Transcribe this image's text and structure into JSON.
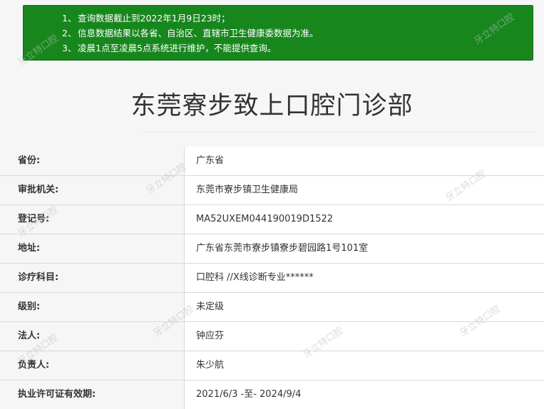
{
  "notice": [
    {
      "num": "1、",
      "text": "查询数据截止到2022年1月9日23时；"
    },
    {
      "num": "2、",
      "text": "信息数据结果以各省、自治区、直辖市卫生健康委数据为准。"
    },
    {
      "num": "3、",
      "text": "凌晨1点至凌晨5点系统进行维护，不能提供查询。"
    }
  ],
  "title": "东莞寮步致上口腔门诊部",
  "rows": [
    {
      "label": "省份:",
      "value": "广东省"
    },
    {
      "label": "审批机关:",
      "value": "东莞市寮步镇卫生健康局"
    },
    {
      "label": "登记号:",
      "value": "MA52UXEM044190019D1522"
    },
    {
      "label": "地址:",
      "value": "广东省东莞市寮步镇寮步碧园路1号101室"
    },
    {
      "label": "诊疗科目:",
      "value": "口腔科 //X线诊断专业******"
    },
    {
      "label": "级别:",
      "value": "未定级"
    },
    {
      "label": "法人:",
      "value": "钟应芬"
    },
    {
      "label": "负责人:",
      "value": "朱少航"
    },
    {
      "label": "执业许可证有效期:",
      "value": "2021/6/3 -至- 2024/9/4"
    }
  ],
  "watermark": "牙立特口腔"
}
